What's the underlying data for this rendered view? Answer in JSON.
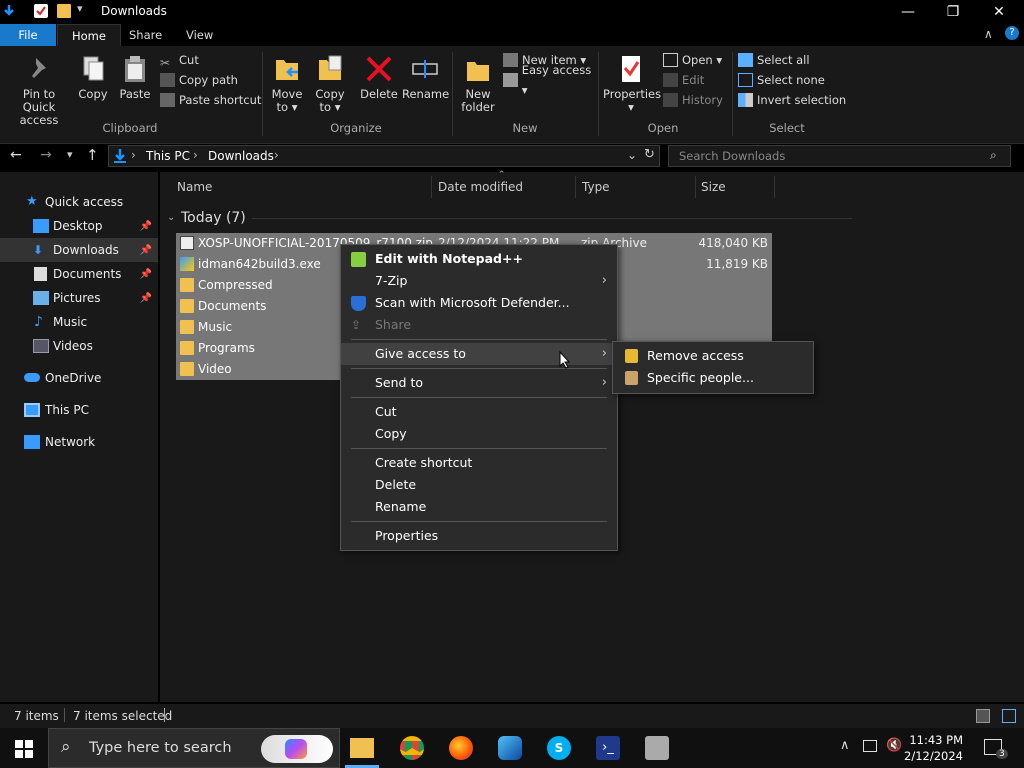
{
  "window": {
    "title": "Downloads"
  },
  "window_buttons": {
    "minimize": "—",
    "maximize": "❐",
    "close": "✕"
  },
  "ribbon_tabs": [
    "File",
    "Home",
    "Share",
    "View"
  ],
  "ribbon": {
    "pin_label_1": "Pin to Quick",
    "pin_label_2": "access",
    "copy": "Copy",
    "paste": "Paste",
    "cut": "Cut",
    "copy_path": "Copy path",
    "paste_shortcut": "Paste shortcut",
    "clipboard": "Clipboard",
    "move_to_1": "Move",
    "move_to_2": "to ▾",
    "copy_to_1": "Copy",
    "copy_to_2": "to ▾",
    "delete": "Delete",
    "rename": "Rename",
    "organize": "Organize",
    "new_folder_1": "New",
    "new_folder_2": "folder",
    "new_item": "New item ▾",
    "easy_access": "Easy access ▾",
    "new": "New",
    "properties": "Properties",
    "open": "Open ▾",
    "edit": "Edit",
    "history": "History",
    "open_group": "Open",
    "select_all": "Select all",
    "select_none": "Select none",
    "invert_selection": "Invert selection",
    "select_group": "Select"
  },
  "address": {
    "crumbs": [
      "This PC",
      "Downloads"
    ],
    "search_placeholder": "Search Downloads"
  },
  "nav": [
    {
      "label": "Quick access",
      "pinned": false
    },
    {
      "label": "Desktop",
      "pinned": true
    },
    {
      "label": "Downloads",
      "pinned": true
    },
    {
      "label": "Documents",
      "pinned": true
    },
    {
      "label": "Pictures",
      "pinned": true
    },
    {
      "label": "Music",
      "pinned": false
    },
    {
      "label": "Videos",
      "pinned": false
    },
    {
      "label": "OneDrive",
      "pinned": false
    },
    {
      "label": "This PC",
      "pinned": false
    },
    {
      "label": "Network",
      "pinned": false
    }
  ],
  "columns": [
    "Name",
    "Date modified",
    "Type",
    "Size"
  ],
  "group": "Today (7)",
  "files": [
    {
      "name": "XOSP-UNOFFICIAL-20170509_r7100.zip",
      "date": "2/12/2024 11:22 PM",
      "type": "zip Archive",
      "size": "418,040 KB"
    },
    {
      "name": "idman642build3.exe",
      "date": "",
      "type": "ation",
      "size": "11,819 KB"
    },
    {
      "name": "Compressed",
      "date": "",
      "type": "der",
      "size": ""
    },
    {
      "name": "Documents",
      "date": "",
      "type": "der",
      "size": ""
    },
    {
      "name": "Music",
      "date": "",
      "type": "der",
      "size": ""
    },
    {
      "name": "Programs",
      "date": "",
      "type": "",
      "size": ""
    },
    {
      "name": "Video",
      "date": "",
      "type": "",
      "size": ""
    }
  ],
  "context_menu": {
    "edit_notepad": "Edit with Notepad++",
    "sevenzip": "7-Zip",
    "scan": "Scan with Microsoft Defender...",
    "share": "Share",
    "give_access": "Give access to",
    "send_to": "Send to",
    "cut": "Cut",
    "copy": "Copy",
    "create_shortcut": "Create shortcut",
    "delete": "Delete",
    "rename": "Rename",
    "properties": "Properties"
  },
  "submenu": {
    "remove_access": "Remove access",
    "specific_people": "Specific people..."
  },
  "status": {
    "items": "7 items",
    "selected": "7 items selected"
  },
  "taskbar": {
    "search_placeholder": "Type here to search",
    "time": "11:43 PM",
    "date": "2/12/2024",
    "notifications": "3"
  },
  "colors": {
    "accent": "#1979ca",
    "folder": "#f0c050",
    "selection": "#777777"
  }
}
